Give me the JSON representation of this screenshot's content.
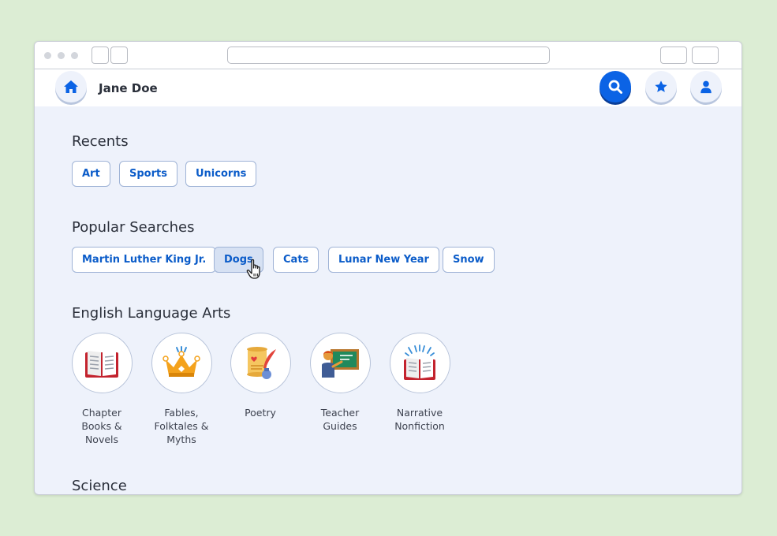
{
  "header": {
    "user_name": "Jane Doe"
  },
  "icons": {
    "home": "home-icon",
    "search": "search-icon",
    "favorites": "star-icon",
    "profile": "user-icon"
  },
  "colors": {
    "accent": "#0b63e5",
    "background": "#dcedd4",
    "content_bg": "#eef2fb",
    "chip_text": "#0b5cc9"
  },
  "recents": {
    "title": "Recents",
    "items": [
      "Art",
      "Sports",
      "Unicorns"
    ]
  },
  "popular": {
    "title": "Popular Searches",
    "items": [
      "Martin Luther King Jr.",
      "Dogs",
      "Cats",
      "Lunar New Year",
      "Snow"
    ],
    "hovered": "Dogs"
  },
  "ela": {
    "title": "English Language Arts",
    "categories": [
      {
        "lines": [
          "Chapter",
          "Books &",
          "Novels"
        ],
        "icon": "book-icon"
      },
      {
        "lines": [
          "Fables,",
          "Folktales &",
          "Myths"
        ],
        "icon": "crown-icon"
      },
      {
        "lines": [
          "Poetry"
        ],
        "icon": "scroll-quill-icon"
      },
      {
        "lines": [
          "Teacher",
          "Guides"
        ],
        "icon": "teacher-chalkboard-icon"
      },
      {
        "lines": [
          "Narrative",
          "Nonfiction"
        ],
        "icon": "sparkle-book-icon"
      }
    ]
  },
  "science": {
    "title": "Science"
  }
}
